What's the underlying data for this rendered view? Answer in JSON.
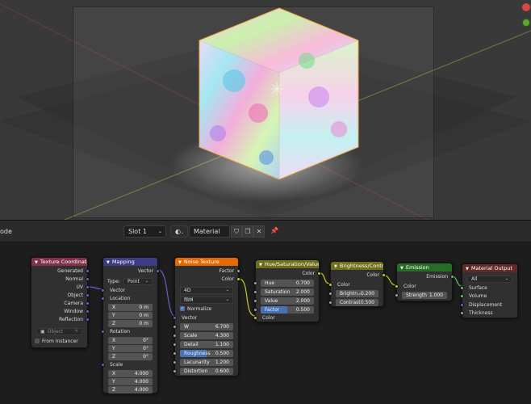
{
  "header": {
    "editor_label": "ode",
    "slot_label": "Slot 1",
    "material_name": "Material",
    "icons": [
      "chevron-down-icon",
      "material-sphere-icon",
      "shield-icon",
      "duplicate-icon",
      "close-icon",
      "pin-icon"
    ]
  },
  "colors": {
    "texture_coordinate_header": "#83314a",
    "mapping_header": "#3c3c83",
    "noise_texture_header": "#e66900",
    "color_node_header": "#6e6e1d",
    "shader_header": "#276d27",
    "output_header": "#632828",
    "socket_vector": "#6363c7",
    "socket_color": "#c7c729",
    "socket_float": "#a1a1a1",
    "socket_shader": "#63c763"
  },
  "nodes": {
    "texcoord": {
      "title": "Texture Coordinate",
      "outputs": [
        "Generated",
        "Normal",
        "UV",
        "Object",
        "Camera",
        "Window",
        "Reflection"
      ],
      "object_placeholder": "Object",
      "from_instancer": "From Instancer"
    },
    "mapping": {
      "title": "Mapping",
      "output": "Vector",
      "type_label": "Type:",
      "type_value": "Point",
      "vector_in": "Vector",
      "location_label": "Location",
      "location": [
        [
          "X",
          "0 m"
        ],
        [
          "Y",
          "0 m"
        ],
        [
          "Z",
          "0 m"
        ]
      ],
      "rotation_label": "Rotation",
      "rotation": [
        [
          "X",
          "0°"
        ],
        [
          "Y",
          "0°"
        ],
        [
          "Z",
          "0°"
        ]
      ],
      "scale_label": "Scale",
      "scale": [
        [
          "X",
          "4.000"
        ],
        [
          "Y",
          "4.000"
        ],
        [
          "Z",
          "4.000"
        ]
      ]
    },
    "noise": {
      "title": "Noise Texture",
      "out_factor": "Factor",
      "out_color": "Color",
      "dimensions": "4D",
      "noise_type": "fBM",
      "normalize": "Normalize",
      "vector_in": "Vector",
      "fields": [
        [
          "W",
          "6.700"
        ],
        [
          "Scale",
          "4.300"
        ],
        [
          "Detail",
          "1.100"
        ],
        [
          "Roughness",
          "0.500"
        ],
        [
          "Lacunarity",
          "1.200"
        ],
        [
          "Distortion",
          "0.600"
        ]
      ],
      "roughness_fill": 0.5
    },
    "hsv": {
      "title": "Hue/Saturation/Value",
      "out_color": "Color",
      "fields": [
        [
          "Hue",
          "0.700"
        ],
        [
          "Saturation",
          "2.000"
        ],
        [
          "Value",
          "2.000"
        ],
        [
          "Factor",
          "0.500"
        ]
      ],
      "factor_fill": 0.5,
      "in_color": "Color"
    },
    "brightcontrast": {
      "title": "Brightness/Contrast",
      "out_color": "Color",
      "in_color": "Color",
      "fields": [
        [
          "Brightn…",
          "-0.200"
        ],
        [
          "Contrast",
          "0.500"
        ]
      ]
    },
    "emission": {
      "title": "Emission",
      "out_emission": "Emission",
      "in_color": "Color",
      "strength_label": "Strength",
      "strength_value": "1.000"
    },
    "output": {
      "title": "Material Output",
      "target": "All",
      "inputs": [
        "Surface",
        "Volume",
        "Displacement",
        "Thickness"
      ]
    }
  }
}
